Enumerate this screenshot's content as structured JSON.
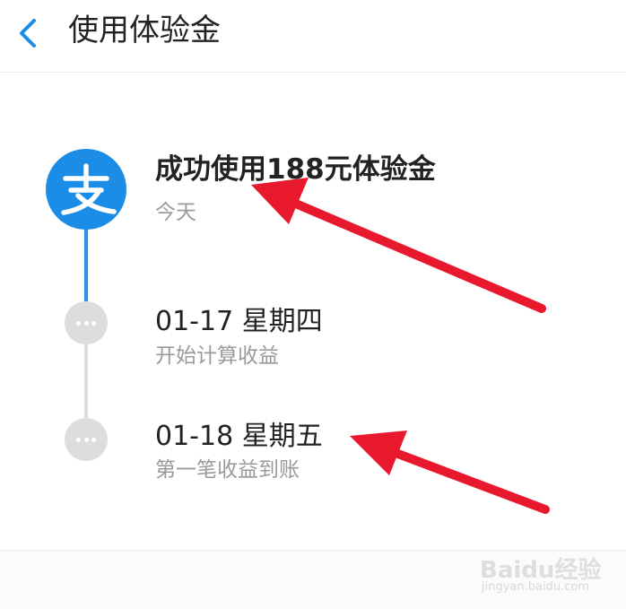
{
  "header": {
    "title": "使用体验金"
  },
  "timeline": [
    {
      "title": "成功使用188元体验金",
      "subtitle": "今天",
      "icon": "alipay-logo-icon",
      "state": "done"
    },
    {
      "title": "01-17 星期四",
      "subtitle": "开始计算收益",
      "icon": "more-dots-icon",
      "state": "pending"
    },
    {
      "title": "01-18 星期五",
      "subtitle": "第一笔收益到账",
      "icon": "more-dots-icon",
      "state": "pending"
    }
  ],
  "watermark": {
    "brand": "Baidu经验",
    "url": "jingyan.baidu.com"
  },
  "colors": {
    "accent": "#1b8de6",
    "annotation_arrow": "#e8192c",
    "pending": "#dddddd",
    "subtitle": "#9a9a9a"
  }
}
